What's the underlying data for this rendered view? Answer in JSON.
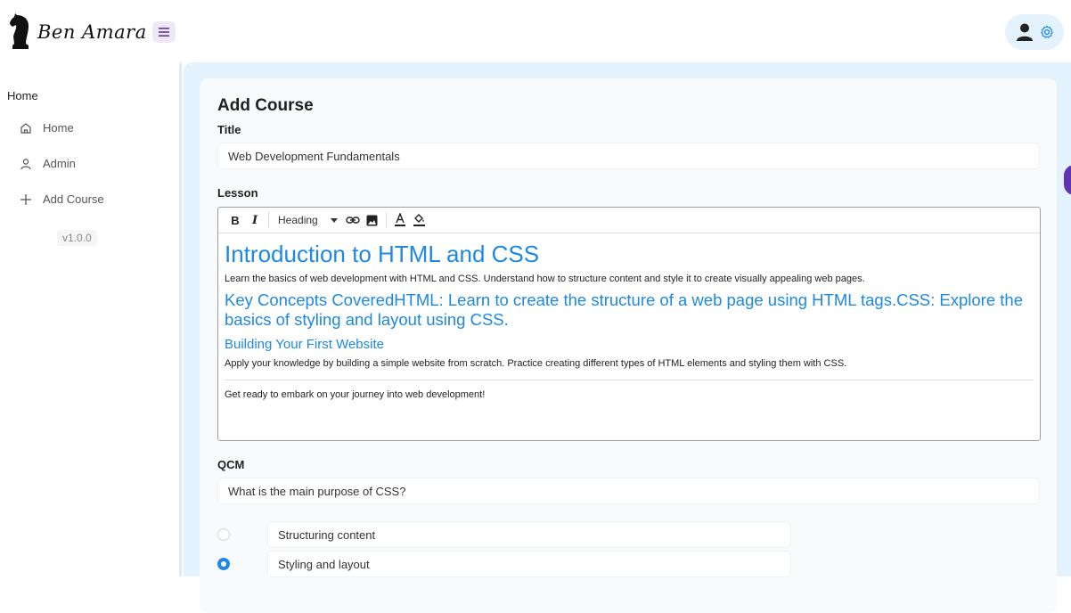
{
  "brand": {
    "name": "Ben Amara"
  },
  "sidebar": {
    "section": "Home",
    "items": [
      {
        "label": "Home",
        "icon": "home-icon"
      },
      {
        "label": "Admin",
        "icon": "user-icon"
      },
      {
        "label": "Add Course",
        "icon": "plus-icon"
      }
    ],
    "version": "v1.0.0"
  },
  "form": {
    "title": "Add Course",
    "title_label": "Title",
    "title_value": "Web Development Fundamentals",
    "lesson_label": "Lesson",
    "toolbar": {
      "bold": "B",
      "italic": "I",
      "heading": "Heading"
    },
    "lesson": {
      "h1": "Introduction to HTML and CSS",
      "p1": "Learn the basics of web development with HTML and CSS. Understand how to structure content and style it to create visually appealing web pages.",
      "h2": "Key Concepts CoveredHTML: Learn to create the structure of a web page using HTML tags.CSS: Explore the basics of styling and layout using CSS.",
      "h3": "Building Your First Website",
      "p2": "Apply your knowledge by building a simple website from scratch. Practice creating different types of HTML elements and styling them with CSS.",
      "p3": "Get ready to embark on your journey into web development!"
    },
    "qcm_label": "QCM",
    "question": "What is the main purpose of CSS?",
    "options": [
      {
        "label": "Structuring content",
        "checked": false
      },
      {
        "label": "Styling and layout",
        "checked": true
      }
    ]
  },
  "colors": {
    "accent": "#1e88e5",
    "background": "#e3f2fd",
    "purple": "#5e35b1"
  }
}
